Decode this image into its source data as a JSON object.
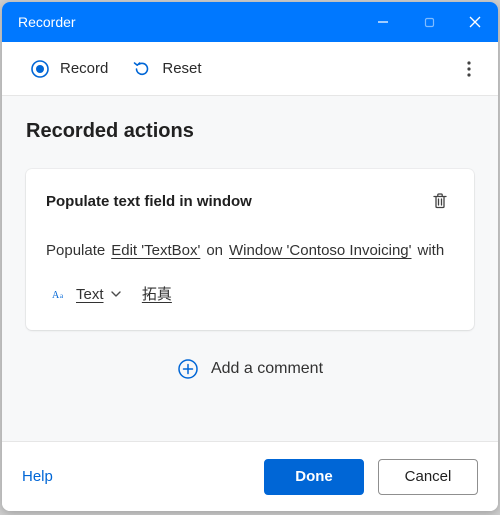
{
  "window": {
    "title": "Recorder"
  },
  "toolbar": {
    "record_label": "Record",
    "reset_label": "Reset"
  },
  "section": {
    "heading": "Recorded actions"
  },
  "action": {
    "title": "Populate text field in window",
    "verb": "Populate",
    "target_element": "Edit 'TextBox'",
    "preposition": "on",
    "target_window": "Window 'Contoso Invoicing'",
    "suffix": "with",
    "value_type_label": "Text",
    "value": "拓真"
  },
  "add_comment_label": "Add a comment",
  "footer": {
    "help_label": "Help",
    "done_label": "Done",
    "cancel_label": "Cancel"
  }
}
